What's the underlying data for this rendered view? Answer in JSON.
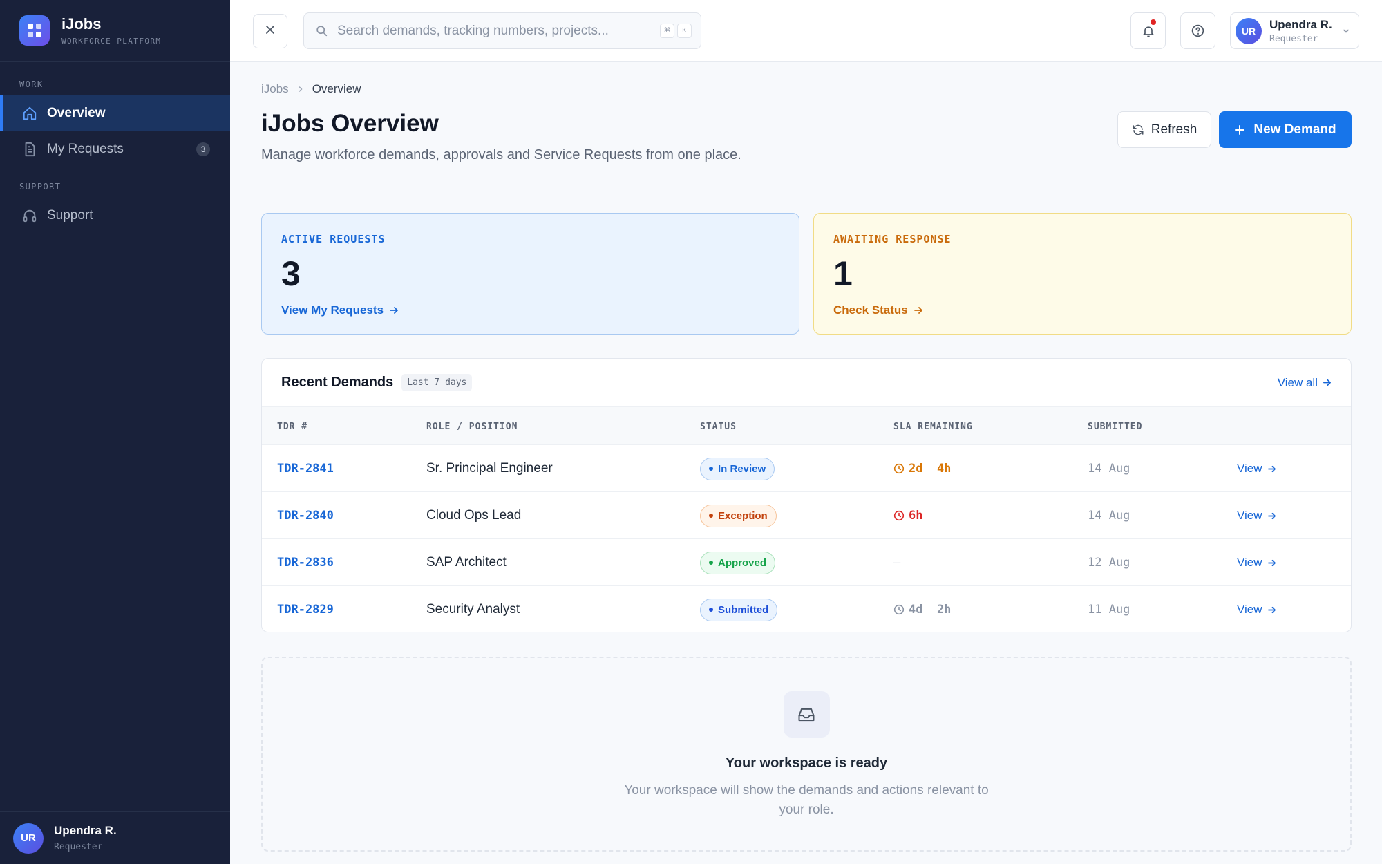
{
  "app": {
    "name": "iJobs",
    "subtitle": "WORKFORCE PLATFORM"
  },
  "sidebar": {
    "sections": [
      {
        "label": "WORK"
      },
      {
        "label": "SUPPORT"
      }
    ],
    "items": [
      {
        "label": "Overview",
        "icon": "home-icon",
        "active": true
      },
      {
        "label": "My Requests",
        "icon": "document-icon",
        "badge": "3"
      },
      {
        "label": "Support",
        "icon": "headset-icon"
      }
    ],
    "user": {
      "initials": "UR",
      "name": "Upendra R.",
      "role": "Requester"
    }
  },
  "topbar": {
    "search_placeholder": "Search demands, tracking numbers, projects...",
    "shortcut": [
      "⌘",
      "K"
    ],
    "user": {
      "initials": "UR",
      "name": "Upendra R.",
      "role": "Requester"
    }
  },
  "breadcrumb": {
    "root": "iJobs",
    "current": "Overview"
  },
  "page": {
    "title": "iJobs Overview",
    "subtitle": "Manage workforce demands, approvals and Service Requests from one place.",
    "refresh_label": "Refresh",
    "new_demand_label": "New Demand"
  },
  "stats": {
    "active": {
      "label": "ACTIVE REQUESTS",
      "value": "3",
      "link": "View My Requests",
      "color": "#1766d6"
    },
    "awaiting": {
      "label": "AWAITING RESPONSE",
      "value": "1",
      "link": "Check Status",
      "color": "#c96a0b"
    }
  },
  "recent": {
    "title": "Recent Demands",
    "range": "Last 7 days",
    "view_all": "View all",
    "columns": [
      "TDR #",
      "ROLE / POSITION",
      "STATUS",
      "SLA REMAINING",
      "SUBMITTED"
    ],
    "rows": [
      {
        "tdr": "TDR-2841",
        "role": "Sr. Principal Engineer",
        "status": "In Review",
        "sla": "2d  4h",
        "submitted": "14 Aug",
        "action": "View"
      },
      {
        "tdr": "TDR-2840",
        "role": "Cloud Ops Lead",
        "status": "Exception",
        "sla": "6h",
        "submitted": "14 Aug",
        "action": "View"
      },
      {
        "tdr": "TDR-2836",
        "role": "SAP Architect",
        "status": "Approved",
        "sla": "—",
        "submitted": "12 Aug",
        "action": "View"
      },
      {
        "tdr": "TDR-2829",
        "role": "Security Analyst",
        "status": "Submitted",
        "sla": "4d  2h",
        "submitted": "11 Aug",
        "action": "View"
      }
    ],
    "status_colors": {
      "In Review": "#1766d6",
      "Exception": "#c2410c",
      "Approved": "#16a34a",
      "Submitted": "#1d4ed8"
    }
  },
  "empty_state": {
    "title": "Your workspace is ready",
    "description": "Your workspace will show the demands and actions relevant to your role."
  }
}
